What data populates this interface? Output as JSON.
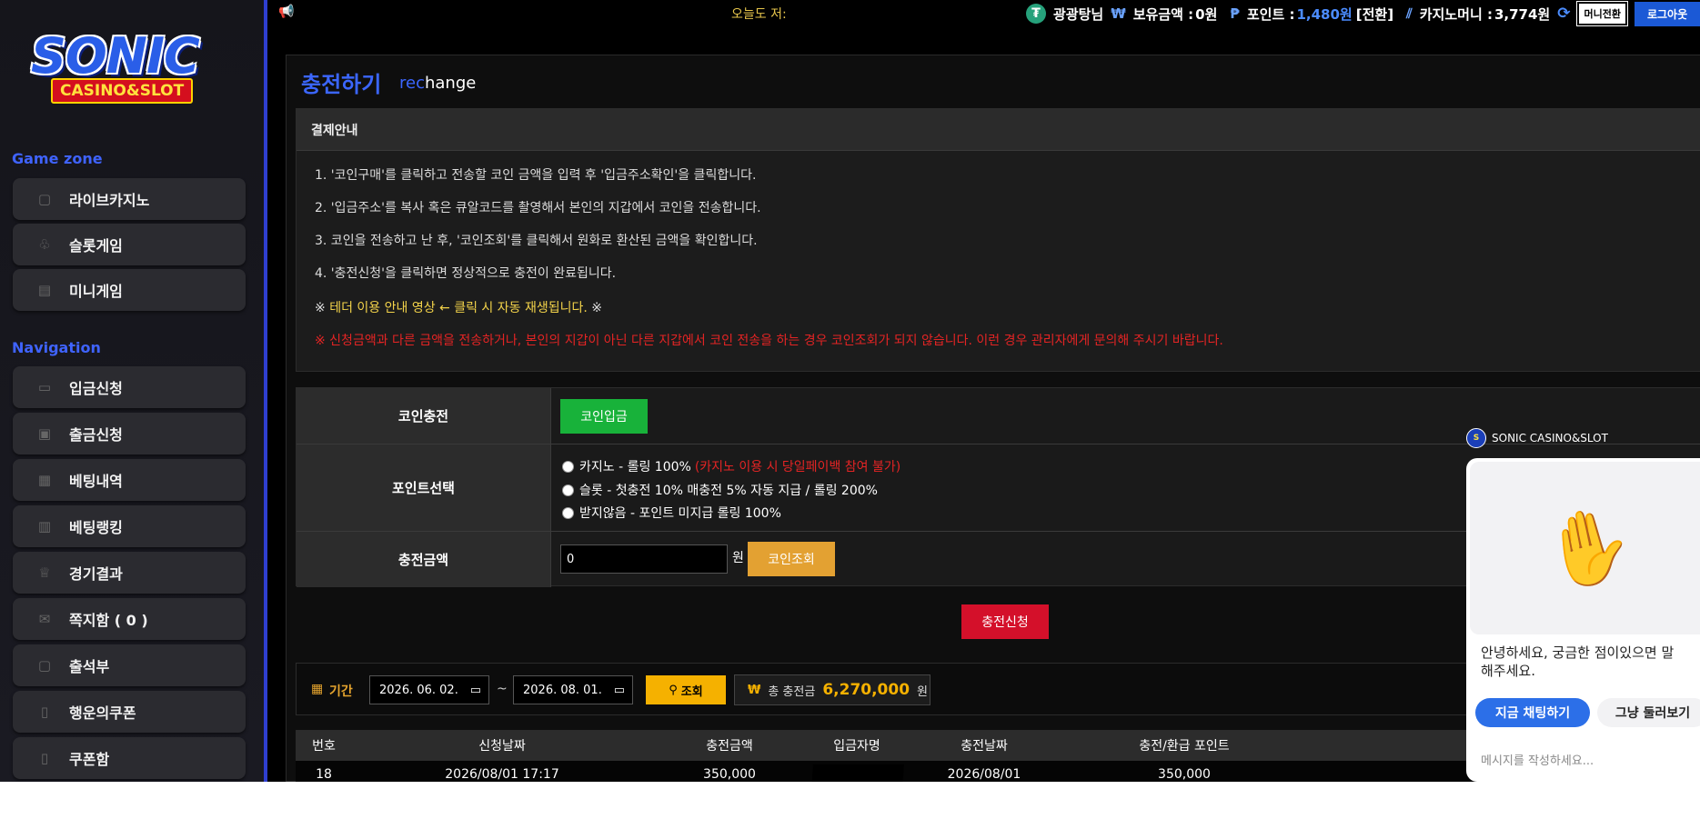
{
  "sidebar": {
    "logo_title": "SONIC",
    "logo_sub": "CASINO&SLOT",
    "game_zone_heading": "Game zone",
    "game_items": [
      {
        "label": "라이브카지노",
        "icon": "cards-icon"
      },
      {
        "label": "슬롯게임",
        "icon": "slot-icon"
      },
      {
        "label": "미니게임",
        "icon": "mini-game-icon"
      }
    ],
    "navigation_heading": "Navigation",
    "nav_items": [
      {
        "label": "입금신청",
        "icon": "deposit-icon"
      },
      {
        "label": "출금신청",
        "icon": "wallet-icon"
      },
      {
        "label": "베팅내역",
        "icon": "receipt-icon"
      },
      {
        "label": "베팅랭킹",
        "icon": "ranking-icon"
      },
      {
        "label": "경기결과",
        "icon": "trophy-icon"
      },
      {
        "label": "쪽지함 ( 0 )",
        "icon": "envelope-icon"
      },
      {
        "label": "출석부",
        "icon": "calendar-icon"
      },
      {
        "label": "행운의쿠폰",
        "icon": "coupon-icon"
      },
      {
        "label": "쿠폰함",
        "icon": "coupon-box-icon"
      }
    ]
  },
  "topbar": {
    "ticker": "오늘도 저:",
    "username": "광광탕님",
    "balance_label": "보유금액 :",
    "balance_value": "0원",
    "point_label": "포인트 :",
    "point_value": "1,480원",
    "point_convert": "[전환]",
    "casino_money_label": "카지노머니 :",
    "casino_money_value": "3,774원",
    "mini_convert_button": "머니전환",
    "logout_button": "로그아웃"
  },
  "page": {
    "title": "충전하기",
    "subtitle_accent": "rec",
    "subtitle_rest": "hange"
  },
  "guide": {
    "heading": "결제안내",
    "lines": [
      "1. '코인구매'를 클릭하고 전송할 코인 금액을 입력 후 '입금주소확인'을 클릭합니다.",
      "2. '입금주소'를 복사 혹은 큐알코드를 촬영해서 본인의 지갑에서 코인을 전송합니다.",
      "3. 코인을 전송하고 난 후, '코인조회'를 클릭해서 원화로 환산된 금액을 확인합니다.",
      "4. '충전신청'을 클릭하면 정상적으로 충전이 완료됩니다."
    ],
    "video_notice_prefix": "※ ",
    "video_notice": "테더 이용 안내 영상 ← 클릭 시 자동 재생됩니다.",
    "video_notice_suffix": " ※",
    "warning": "※ 신청금액과 다른 금액을 전송하거나, 본인의 지갑이 아닌 다른 지갑에서 코인 전송을 하는 경우 코인조회가 되지 않습니다. 이런 경우 관리자에게 문의해 주시기 바랍니다."
  },
  "form": {
    "coin_charge_label": "코인충전",
    "coin_deposit_button": "코인입금",
    "point_select_label": "포인트선택",
    "point_options": [
      {
        "text": "카지노 - 롤링 100%",
        "note": "(카지노 이용 시 당일페이백 참여 불가)"
      },
      {
        "text": "슬롯 - 첫충전 10% 매충전 5% 자동 지급 / 롤링 200%",
        "note": ""
      },
      {
        "text": "받지않음 - 포인트 미지급 롤링 100%",
        "note": ""
      }
    ],
    "amount_label": "충전금액",
    "amount_value": "0",
    "won_unit": "원",
    "coin_check_button": "코인조회",
    "submit_button": "충전신청"
  },
  "filter": {
    "period_label": "기간",
    "date_from": "2026. 06. 02.",
    "tilde": "~",
    "date_to": "2026. 08. 01.",
    "search_button": "조회",
    "total_currency": "₩",
    "total_label": "총 충전금",
    "total_value": "6,270,000",
    "total_unit": "원"
  },
  "table": {
    "headers": [
      "번호",
      "신청날짜",
      "충전금액",
      "입금자명",
      "충전날짜",
      "충전/환급 포인트"
    ],
    "rows": [
      [
        "18",
        "2026/08/01 17:17",
        "350,000",
        "",
        "2026/08/01",
        "350,000"
      ]
    ]
  },
  "chat": {
    "brand": "SONIC CASINO&SLOT",
    "message": "안녕하세요, 궁금한 점이있으면 말\n해주세요.",
    "start_button": "지금 채팅하기",
    "browse_button": "그냥 둘러보기",
    "input_placeholder": "메시지를 작성하세요..."
  }
}
